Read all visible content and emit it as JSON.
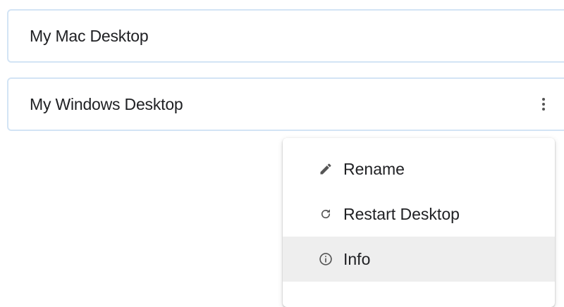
{
  "desktops": [
    {
      "label": "My Mac Desktop"
    },
    {
      "label": "My Windows Desktop"
    }
  ],
  "context_menu": {
    "items": [
      {
        "label": "Rename",
        "icon": "pencil-icon"
      },
      {
        "label": "Restart Desktop",
        "icon": "restart-icon"
      },
      {
        "label": "Info",
        "icon": "info-icon",
        "highlighted": true
      }
    ]
  },
  "colors": {
    "card_border": "#d3e4f5",
    "highlight": "#eeeeee",
    "icon": "#555555",
    "text": "#202124"
  }
}
